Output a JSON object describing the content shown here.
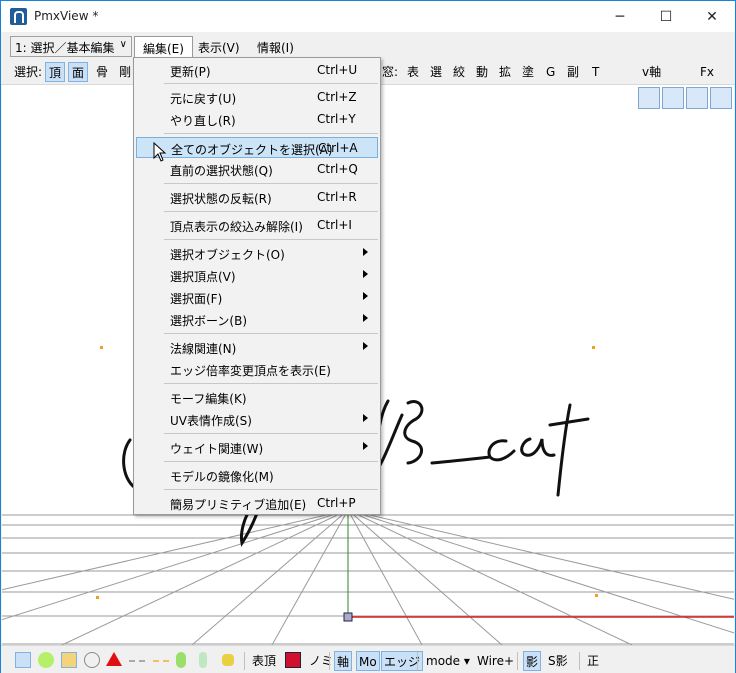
{
  "window": {
    "title": "PmxView *",
    "minimize": "─",
    "maximize": "☐",
    "close": "✕"
  },
  "menubar": {
    "mode": "1: 選択／基本編集",
    "items": [
      "編集(E)",
      "表示(V)",
      "情報(I)"
    ]
  },
  "toolbar": {
    "select_label": "選択:",
    "left_items": [
      "頂",
      "面",
      "骨",
      "剛"
    ],
    "window_label": "窓:",
    "right_items": [
      "表",
      "選",
      "絞",
      "動",
      "拡",
      "塗",
      "G",
      "副",
      "T"
    ],
    "v_axis": "v軸",
    "fx": "Fx"
  },
  "dropdown": {
    "items": [
      {
        "label": "更新(P)",
        "shortcut": "Ctrl+U"
      },
      {
        "label": "元に戻す(U)",
        "shortcut": "Ctrl+Z"
      },
      {
        "label": "やり直し(R)",
        "shortcut": "Ctrl+Y"
      },
      {
        "label": "全てのオブジェクトを選択(A)",
        "shortcut": "Ctrl+A"
      },
      {
        "label": "直前の選択状態(Q)",
        "shortcut": "Ctrl+Q"
      },
      {
        "label": "選択状態の反転(R)",
        "shortcut": "Ctrl+R"
      },
      {
        "label": "頂点表示の絞込み解除(I)",
        "shortcut": "Ctrl+I"
      },
      {
        "label": "選択オブジェクト(O)",
        "shortcut": ""
      },
      {
        "label": "選択頂点(V)",
        "shortcut": ""
      },
      {
        "label": "選択面(F)",
        "shortcut": ""
      },
      {
        "label": "選択ボーン(B)",
        "shortcut": ""
      },
      {
        "label": "法線関連(N)",
        "shortcut": ""
      },
      {
        "label": "エッジ倍率変更頂点を表示(E)",
        "shortcut": ""
      },
      {
        "label": "モーフ編集(K)",
        "shortcut": ""
      },
      {
        "label": "UV表情作成(S)",
        "shortcut": ""
      },
      {
        "label": "ウェイト関連(W)",
        "shortcut": ""
      },
      {
        "label": "モデルの鏡像化(M)",
        "shortcut": ""
      },
      {
        "label": "簡易プリミティブ追加(E)",
        "shortcut": "Ctrl+P"
      }
    ]
  },
  "statusbar": {
    "table_label": "表頂",
    "no_label": "ノミ",
    "axis_label": "軸",
    "mo_label": "Mo",
    "edge_label": "エッジ",
    "mode_label": "mode",
    "wire_label": "Wire+",
    "shadow_label": "影",
    "sshadow_label": "S影",
    "front_label": "正"
  },
  "colors": {
    "highlight": "#cce4f7",
    "accent": "#1883d7"
  }
}
